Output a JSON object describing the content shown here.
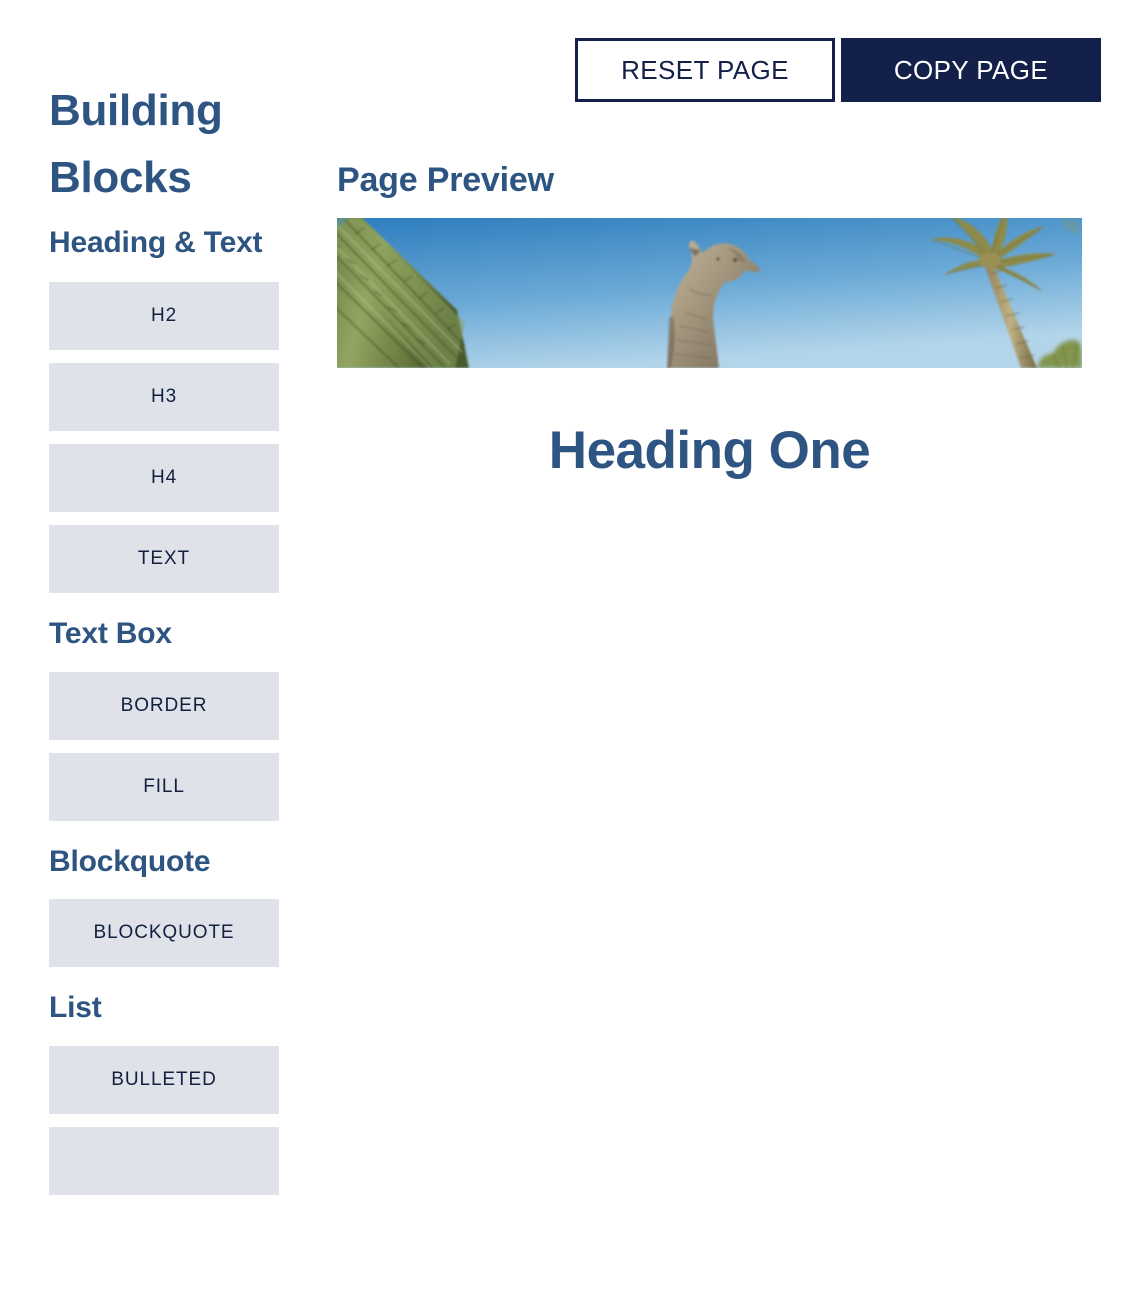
{
  "toolbar": {
    "reset_label": "RESET PAGE",
    "copy_label": "COPY PAGE"
  },
  "sidebar": {
    "title": "Building Blocks",
    "groups": [
      {
        "heading": "Heading & Text",
        "buttons": [
          {
            "label": "H2"
          },
          {
            "label": "H3"
          },
          {
            "label": "H4"
          },
          {
            "label": "TEXT"
          }
        ]
      },
      {
        "heading": "Text Box",
        "buttons": [
          {
            "label": "BORDER"
          },
          {
            "label": "FILL"
          }
        ]
      },
      {
        "heading": "Blockquote",
        "buttons": [
          {
            "label": "BLOCKQUOTE"
          }
        ]
      },
      {
        "heading": "List",
        "buttons": [
          {
            "label": "BULLETED"
          },
          {
            "label": ""
          }
        ]
      }
    ]
  },
  "preview": {
    "title": "Page Preview",
    "hero_image": {
      "name": "wildcat-statue-banner",
      "description": "Stone wildcat statue with saguaro cactus and palm tree against blue sky",
      "sky_top": "#2f7fc0",
      "sky_bottom": "#a8cfe8",
      "cactus_color": "#7c8c4e",
      "statue_color": "#a89a80",
      "palm_color": "#9a8f62"
    },
    "heading_one": "Heading One"
  },
  "colors": {
    "accent_blue": "#2e5582",
    "navy": "#12204a",
    "button_fill": "#dfe3e9",
    "button_text": "#13213f",
    "page_bg": "#ffffff"
  }
}
